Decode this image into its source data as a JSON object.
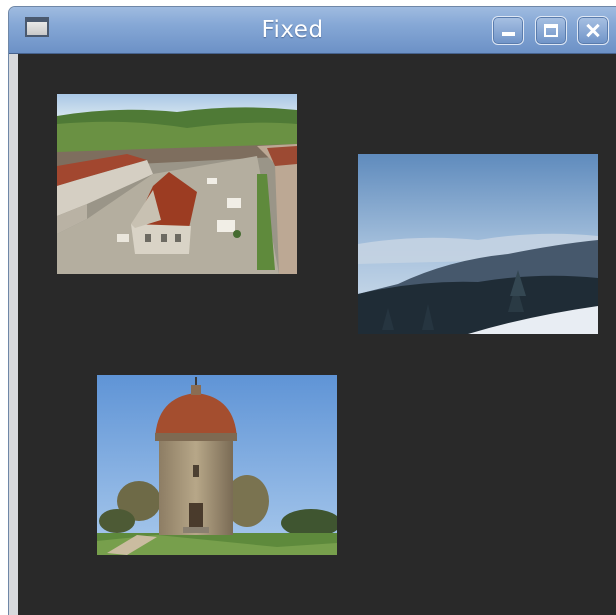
{
  "window": {
    "title": "Fixed",
    "icon": "window-icon",
    "controls": [
      "minimize-icon",
      "maximize-icon",
      "close-icon"
    ]
  },
  "client": {
    "background": "#292929"
  },
  "images": [
    {
      "name": "town-square-photo"
    },
    {
      "name": "winter-mountain-photo"
    },
    {
      "name": "rotunda-tower-photo"
    }
  ]
}
